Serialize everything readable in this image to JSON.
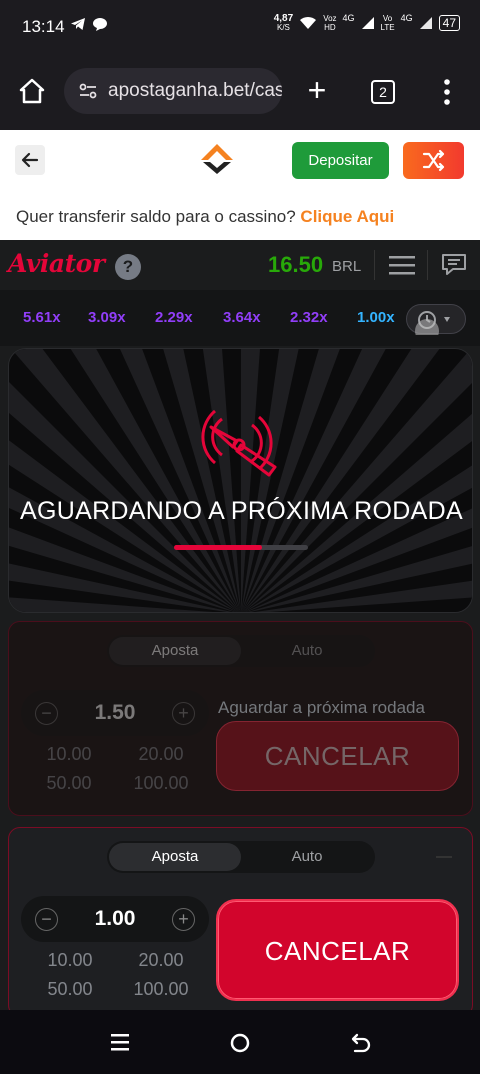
{
  "status": {
    "time": "13:14",
    "net_speed_value": "4,87",
    "net_speed_unit": "K/S",
    "volte1_top": "Voz",
    "volte1_bottom": "HD",
    "net1": "4G",
    "volte2_top": "Vo",
    "volte2_bottom": "LTE",
    "net2": "4G",
    "battery": "47"
  },
  "browser": {
    "url": "apostaganha.bet/cas",
    "tab_count": "2"
  },
  "site": {
    "deposit_label": "Depositar",
    "transfer_question": "Quer transferir saldo para o cassino? ",
    "transfer_link": "Clique Aqui"
  },
  "game": {
    "logo_text": "Aviator",
    "help_label": "?",
    "balance": "16.50",
    "currency": "BRL",
    "history": [
      "5.61x",
      "3.09x",
      "2.29x",
      "3.64x",
      "2.32x",
      "1.00x"
    ],
    "history_colors": [
      "#913ef8",
      "#913ef8",
      "#913ef8",
      "#913ef8",
      "#913ef8",
      "#34b4ff"
    ],
    "waiting_text": "AGUARDANDO A PRÓXIMA RODADA",
    "progress_fraction": 0.66
  },
  "bet1": {
    "tab_bet": "Aposta",
    "tab_auto": "Auto",
    "amount": "1.50",
    "quick": [
      "10.00",
      "20.00",
      "50.00",
      "100.00"
    ],
    "waiting_label": "Aguardar a próxima rodada",
    "cancel_label": "CANCELAR"
  },
  "bet2": {
    "tab_bet": "Aposta",
    "tab_auto": "Auto",
    "amount": "1.00",
    "quick": [
      "10.00",
      "20.00",
      "50.00",
      "100.00"
    ],
    "cancel_label": "CANCELAR"
  },
  "colors": {
    "accent_red": "#e50539",
    "balance_green": "#28a909",
    "deposit_green": "#1f9b3a",
    "link_orange": "#f58220"
  }
}
